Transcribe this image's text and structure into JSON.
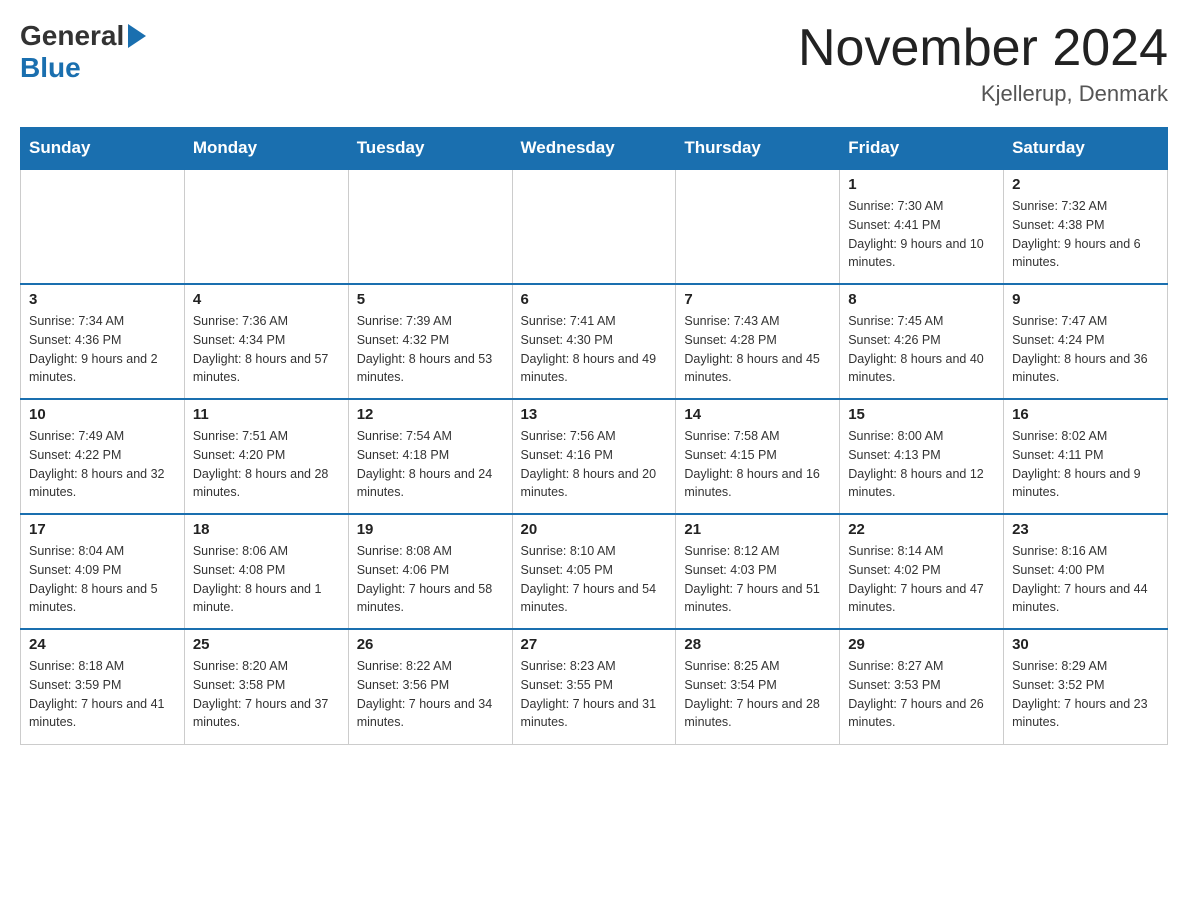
{
  "logo": {
    "general": "General",
    "blue": "Blue"
  },
  "header": {
    "month_title": "November 2024",
    "location": "Kjellerup, Denmark"
  },
  "days_of_week": [
    "Sunday",
    "Monday",
    "Tuesday",
    "Wednesday",
    "Thursday",
    "Friday",
    "Saturday"
  ],
  "weeks": [
    [
      {
        "day": "",
        "info": ""
      },
      {
        "day": "",
        "info": ""
      },
      {
        "day": "",
        "info": ""
      },
      {
        "day": "",
        "info": ""
      },
      {
        "day": "",
        "info": ""
      },
      {
        "day": "1",
        "info": "Sunrise: 7:30 AM\nSunset: 4:41 PM\nDaylight: 9 hours and 10 minutes."
      },
      {
        "day": "2",
        "info": "Sunrise: 7:32 AM\nSunset: 4:38 PM\nDaylight: 9 hours and 6 minutes."
      }
    ],
    [
      {
        "day": "3",
        "info": "Sunrise: 7:34 AM\nSunset: 4:36 PM\nDaylight: 9 hours and 2 minutes."
      },
      {
        "day": "4",
        "info": "Sunrise: 7:36 AM\nSunset: 4:34 PM\nDaylight: 8 hours and 57 minutes."
      },
      {
        "day": "5",
        "info": "Sunrise: 7:39 AM\nSunset: 4:32 PM\nDaylight: 8 hours and 53 minutes."
      },
      {
        "day": "6",
        "info": "Sunrise: 7:41 AM\nSunset: 4:30 PM\nDaylight: 8 hours and 49 minutes."
      },
      {
        "day": "7",
        "info": "Sunrise: 7:43 AM\nSunset: 4:28 PM\nDaylight: 8 hours and 45 minutes."
      },
      {
        "day": "8",
        "info": "Sunrise: 7:45 AM\nSunset: 4:26 PM\nDaylight: 8 hours and 40 minutes."
      },
      {
        "day": "9",
        "info": "Sunrise: 7:47 AM\nSunset: 4:24 PM\nDaylight: 8 hours and 36 minutes."
      }
    ],
    [
      {
        "day": "10",
        "info": "Sunrise: 7:49 AM\nSunset: 4:22 PM\nDaylight: 8 hours and 32 minutes."
      },
      {
        "day": "11",
        "info": "Sunrise: 7:51 AM\nSunset: 4:20 PM\nDaylight: 8 hours and 28 minutes."
      },
      {
        "day": "12",
        "info": "Sunrise: 7:54 AM\nSunset: 4:18 PM\nDaylight: 8 hours and 24 minutes."
      },
      {
        "day": "13",
        "info": "Sunrise: 7:56 AM\nSunset: 4:16 PM\nDaylight: 8 hours and 20 minutes."
      },
      {
        "day": "14",
        "info": "Sunrise: 7:58 AM\nSunset: 4:15 PM\nDaylight: 8 hours and 16 minutes."
      },
      {
        "day": "15",
        "info": "Sunrise: 8:00 AM\nSunset: 4:13 PM\nDaylight: 8 hours and 12 minutes."
      },
      {
        "day": "16",
        "info": "Sunrise: 8:02 AM\nSunset: 4:11 PM\nDaylight: 8 hours and 9 minutes."
      }
    ],
    [
      {
        "day": "17",
        "info": "Sunrise: 8:04 AM\nSunset: 4:09 PM\nDaylight: 8 hours and 5 minutes."
      },
      {
        "day": "18",
        "info": "Sunrise: 8:06 AM\nSunset: 4:08 PM\nDaylight: 8 hours and 1 minute."
      },
      {
        "day": "19",
        "info": "Sunrise: 8:08 AM\nSunset: 4:06 PM\nDaylight: 7 hours and 58 minutes."
      },
      {
        "day": "20",
        "info": "Sunrise: 8:10 AM\nSunset: 4:05 PM\nDaylight: 7 hours and 54 minutes."
      },
      {
        "day": "21",
        "info": "Sunrise: 8:12 AM\nSunset: 4:03 PM\nDaylight: 7 hours and 51 minutes."
      },
      {
        "day": "22",
        "info": "Sunrise: 8:14 AM\nSunset: 4:02 PM\nDaylight: 7 hours and 47 minutes."
      },
      {
        "day": "23",
        "info": "Sunrise: 8:16 AM\nSunset: 4:00 PM\nDaylight: 7 hours and 44 minutes."
      }
    ],
    [
      {
        "day": "24",
        "info": "Sunrise: 8:18 AM\nSunset: 3:59 PM\nDaylight: 7 hours and 41 minutes."
      },
      {
        "day": "25",
        "info": "Sunrise: 8:20 AM\nSunset: 3:58 PM\nDaylight: 7 hours and 37 minutes."
      },
      {
        "day": "26",
        "info": "Sunrise: 8:22 AM\nSunset: 3:56 PM\nDaylight: 7 hours and 34 minutes."
      },
      {
        "day": "27",
        "info": "Sunrise: 8:23 AM\nSunset: 3:55 PM\nDaylight: 7 hours and 31 minutes."
      },
      {
        "day": "28",
        "info": "Sunrise: 8:25 AM\nSunset: 3:54 PM\nDaylight: 7 hours and 28 minutes."
      },
      {
        "day": "29",
        "info": "Sunrise: 8:27 AM\nSunset: 3:53 PM\nDaylight: 7 hours and 26 minutes."
      },
      {
        "day": "30",
        "info": "Sunrise: 8:29 AM\nSunset: 3:52 PM\nDaylight: 7 hours and 23 minutes."
      }
    ]
  ]
}
